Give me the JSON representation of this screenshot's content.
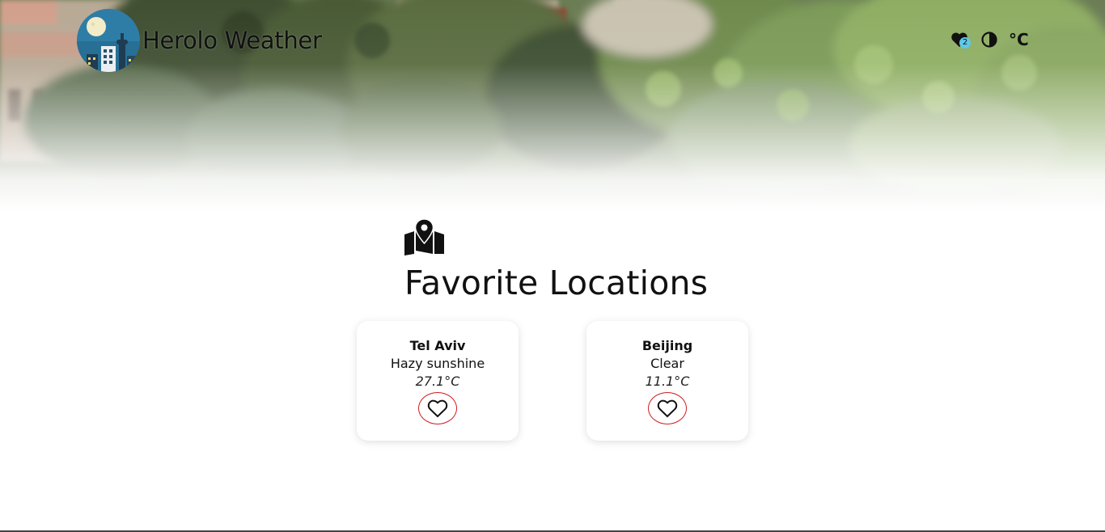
{
  "app": {
    "title": "Herolo Weather"
  },
  "header": {
    "favorites_count": "2",
    "unit_label": "°C",
    "favorites_icon": "heart-icon",
    "theme_icon": "contrast-icon"
  },
  "favorites_page": {
    "section_icon": "map-marker-icon",
    "title": "Favorite Locations",
    "locations": [
      {
        "city": "Tel Aviv",
        "condition": "Hazy sunshine",
        "temperature": "27.1°C"
      },
      {
        "city": "Beijing",
        "condition": "Clear",
        "temperature": "11.1°C"
      }
    ]
  },
  "colors": {
    "accent_red": "#d21b1b",
    "badge_blue": "#5fc8e8",
    "text": "#111111"
  }
}
